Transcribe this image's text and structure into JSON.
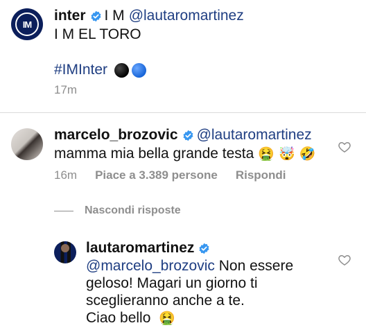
{
  "post": {
    "username": "inter",
    "prefix": "I M",
    "mention": "@lautaromartinez",
    "text": "I M EL TORO",
    "hashtag": "#IMInter",
    "time": "17m"
  },
  "comment": {
    "username": "marcelo_brozovic",
    "mention": "@lautaromartinez",
    "text": "mamma mia bella grande testa",
    "emojis": [
      "🤮",
      "🤯",
      "🤣"
    ],
    "time": "16m",
    "likes": "Piace a 3.389 persone",
    "reply": "Rispondi"
  },
  "hide_replies": "Nascondi risposte",
  "reply": {
    "username": "lautaromartinez",
    "mention": "@marcelo_brozovic",
    "line1": "Non essere",
    "line2": "geloso! Magari un giorno ti",
    "line3": "sceglieranno anche a te.",
    "line4": "Ciao bello",
    "emoji": "🤮"
  },
  "colors": {
    "mention": "#1f3e82",
    "verified": "#3897f0",
    "muted": "#8e8e8e"
  },
  "icons": [
    "verified-badge-icon",
    "heart-icon"
  ]
}
